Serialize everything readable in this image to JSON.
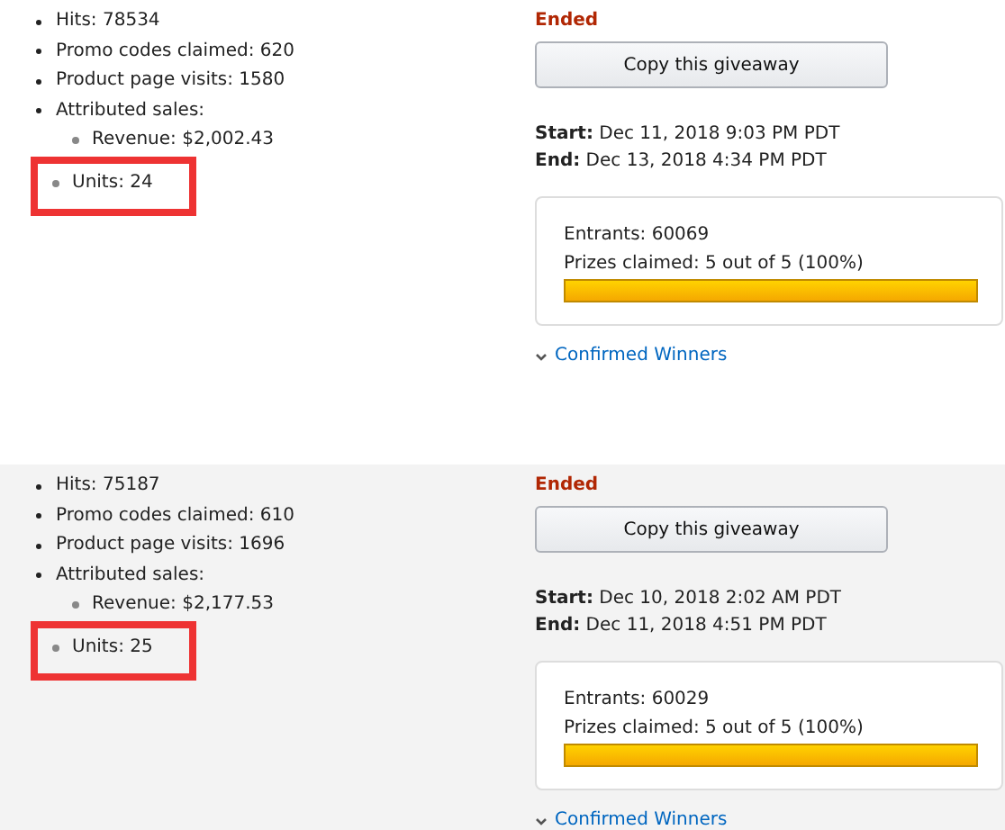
{
  "giveaways": [
    {
      "shaded": false,
      "stats": [
        "Hits: 78534",
        "Promo codes claimed: 620",
        "Product page visits: 1580",
        "Attributed sales:"
      ],
      "sales": [
        {
          "text": "Revenue: $2,002.43",
          "highlighted": false
        },
        {
          "text": "Units: 24",
          "highlighted": true
        }
      ],
      "status": "Ended",
      "copy_button": "Copy this giveaway",
      "start_label": "Start:",
      "start": "Dec 11, 2018 9:03 PM PDT",
      "end_label": "End:",
      "end": "Dec 13, 2018 4:34 PM PDT",
      "entrants": "Entrants: 60069",
      "prizes": "Prizes claimed: 5  out of 5 (100%)",
      "level": 1,
      "winners_link": "Confirmed Winners"
    },
    {
      "shaded": true,
      "stats": [
        "Hits: 75187",
        "Promo codes claimed: 610",
        "Product page visits: 1696",
        "Attributed sales:"
      ],
      "sales": [
        {
          "text": "Revenue: $2,177.53",
          "highlighted": false
        },
        {
          "text": "Units: 25",
          "highlighted": true
        }
      ],
      "status": "Ended",
      "copy_button": "Copy this giveaway",
      "start_label": "Start:",
      "start": "Dec 10, 2018 2:02 AM PDT",
      "end_label": "End:",
      "end": "Dec 11, 2018 4:51 PM PDT",
      "entrants": "Entrants: 60029",
      "prizes": "Prizes claimed: 5  out of 5 (100%)",
      "level": 1,
      "winners_link": "Confirmed Winners"
    }
  ]
}
